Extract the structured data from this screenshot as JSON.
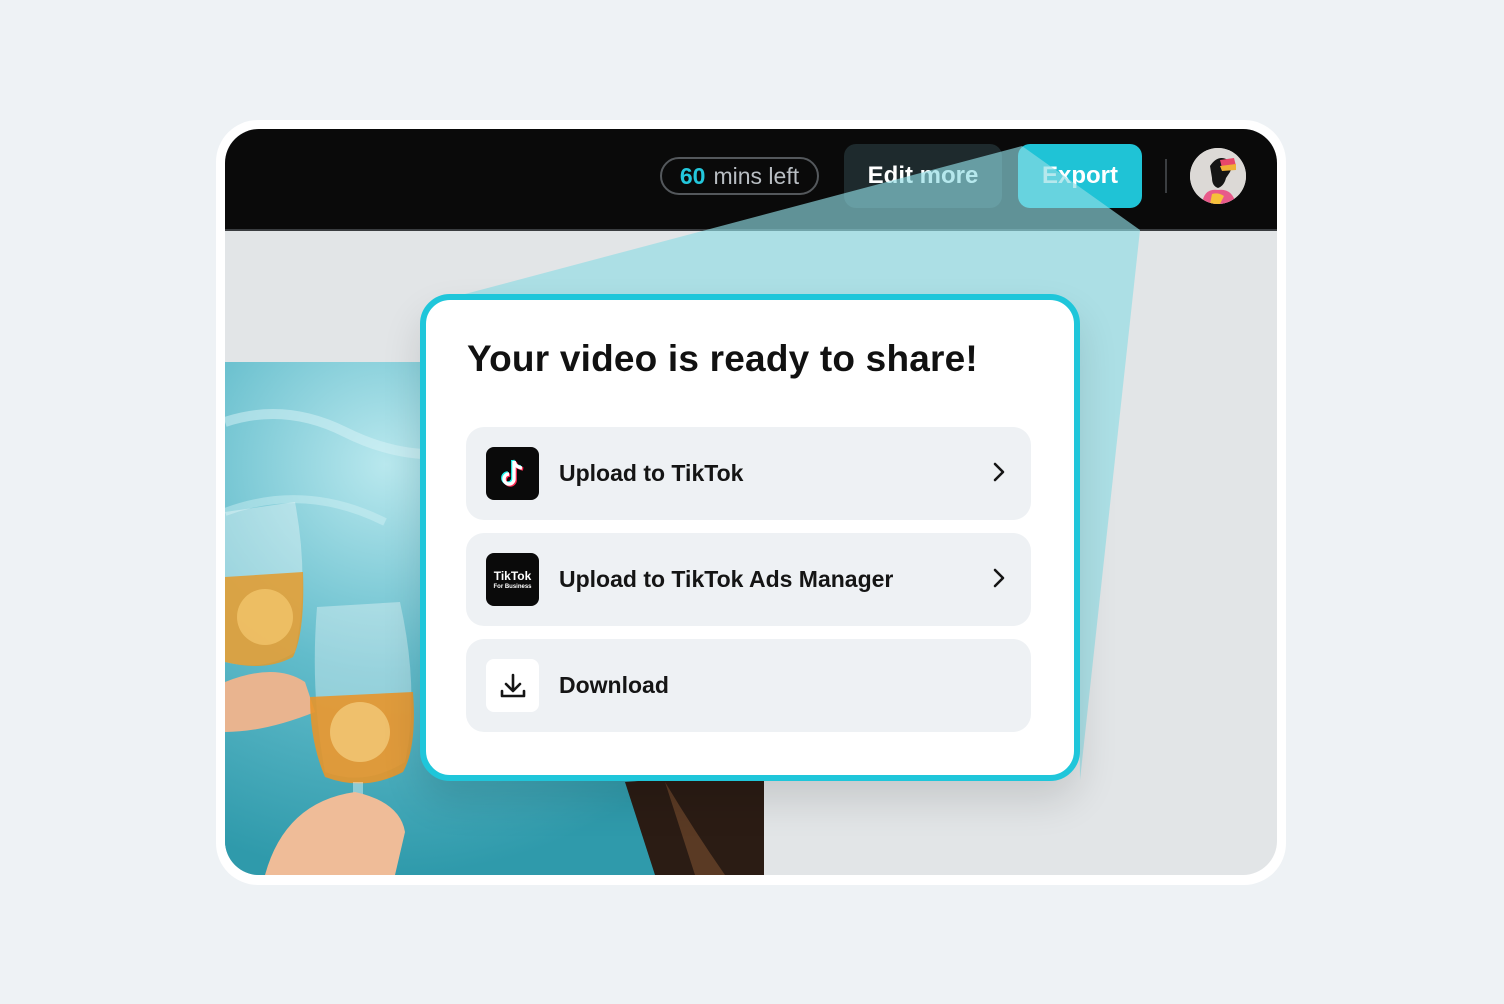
{
  "topbar": {
    "timer_value": "60",
    "timer_suffix": "mins left",
    "edit_label": "Edit more",
    "export_label": "Export"
  },
  "modal": {
    "title": "Your video is ready to share!",
    "options": [
      {
        "label": "Upload to TikTok",
        "icon": "tiktok-logo-icon",
        "has_chevron": true
      },
      {
        "label": "Upload to TikTok Ads Manager",
        "icon": "tiktok-for-business-logo-icon",
        "logo_text": "TikTok",
        "logo_subtext": "For Business",
        "has_chevron": true
      },
      {
        "label": "Download",
        "icon": "download-icon",
        "has_chevron": false
      }
    ]
  },
  "colors": {
    "accent": "#1fc6da",
    "topbar_bg": "#0a0a0a",
    "page_bg": "#eef2f5"
  }
}
